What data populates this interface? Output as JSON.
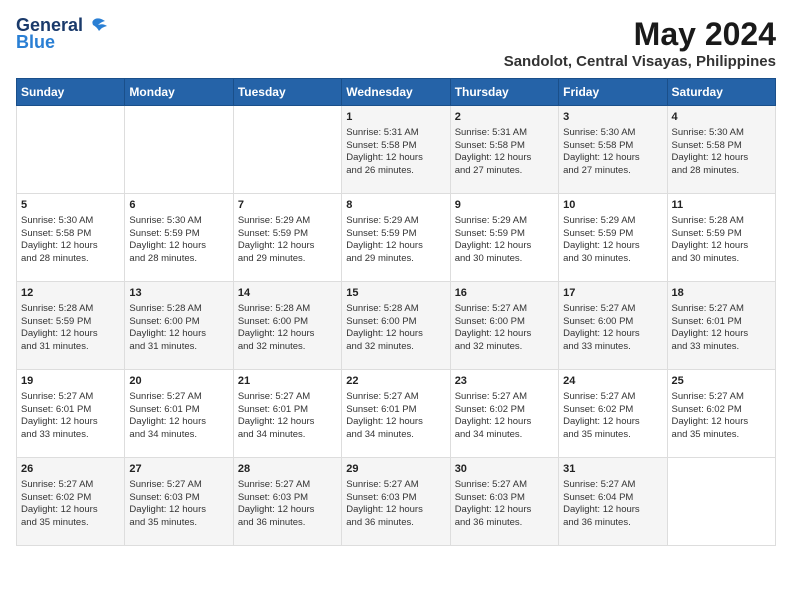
{
  "header": {
    "logo_line1": "General",
    "logo_line2": "Blue",
    "month": "May 2024",
    "location": "Sandolot, Central Visayas, Philippines"
  },
  "days_of_week": [
    "Sunday",
    "Monday",
    "Tuesday",
    "Wednesday",
    "Thursday",
    "Friday",
    "Saturday"
  ],
  "weeks": [
    [
      {
        "day": "",
        "content": ""
      },
      {
        "day": "",
        "content": ""
      },
      {
        "day": "",
        "content": ""
      },
      {
        "day": "1",
        "content": "Sunrise: 5:31 AM\nSunset: 5:58 PM\nDaylight: 12 hours\nand 26 minutes."
      },
      {
        "day": "2",
        "content": "Sunrise: 5:31 AM\nSunset: 5:58 PM\nDaylight: 12 hours\nand 27 minutes."
      },
      {
        "day": "3",
        "content": "Sunrise: 5:30 AM\nSunset: 5:58 PM\nDaylight: 12 hours\nand 27 minutes."
      },
      {
        "day": "4",
        "content": "Sunrise: 5:30 AM\nSunset: 5:58 PM\nDaylight: 12 hours\nand 28 minutes."
      }
    ],
    [
      {
        "day": "5",
        "content": "Sunrise: 5:30 AM\nSunset: 5:58 PM\nDaylight: 12 hours\nand 28 minutes."
      },
      {
        "day": "6",
        "content": "Sunrise: 5:30 AM\nSunset: 5:59 PM\nDaylight: 12 hours\nand 28 minutes."
      },
      {
        "day": "7",
        "content": "Sunrise: 5:29 AM\nSunset: 5:59 PM\nDaylight: 12 hours\nand 29 minutes."
      },
      {
        "day": "8",
        "content": "Sunrise: 5:29 AM\nSunset: 5:59 PM\nDaylight: 12 hours\nand 29 minutes."
      },
      {
        "day": "9",
        "content": "Sunrise: 5:29 AM\nSunset: 5:59 PM\nDaylight: 12 hours\nand 30 minutes."
      },
      {
        "day": "10",
        "content": "Sunrise: 5:29 AM\nSunset: 5:59 PM\nDaylight: 12 hours\nand 30 minutes."
      },
      {
        "day": "11",
        "content": "Sunrise: 5:28 AM\nSunset: 5:59 PM\nDaylight: 12 hours\nand 30 minutes."
      }
    ],
    [
      {
        "day": "12",
        "content": "Sunrise: 5:28 AM\nSunset: 5:59 PM\nDaylight: 12 hours\nand 31 minutes."
      },
      {
        "day": "13",
        "content": "Sunrise: 5:28 AM\nSunset: 6:00 PM\nDaylight: 12 hours\nand 31 minutes."
      },
      {
        "day": "14",
        "content": "Sunrise: 5:28 AM\nSunset: 6:00 PM\nDaylight: 12 hours\nand 32 minutes."
      },
      {
        "day": "15",
        "content": "Sunrise: 5:28 AM\nSunset: 6:00 PM\nDaylight: 12 hours\nand 32 minutes."
      },
      {
        "day": "16",
        "content": "Sunrise: 5:27 AM\nSunset: 6:00 PM\nDaylight: 12 hours\nand 32 minutes."
      },
      {
        "day": "17",
        "content": "Sunrise: 5:27 AM\nSunset: 6:00 PM\nDaylight: 12 hours\nand 33 minutes."
      },
      {
        "day": "18",
        "content": "Sunrise: 5:27 AM\nSunset: 6:01 PM\nDaylight: 12 hours\nand 33 minutes."
      }
    ],
    [
      {
        "day": "19",
        "content": "Sunrise: 5:27 AM\nSunset: 6:01 PM\nDaylight: 12 hours\nand 33 minutes."
      },
      {
        "day": "20",
        "content": "Sunrise: 5:27 AM\nSunset: 6:01 PM\nDaylight: 12 hours\nand 34 minutes."
      },
      {
        "day": "21",
        "content": "Sunrise: 5:27 AM\nSunset: 6:01 PM\nDaylight: 12 hours\nand 34 minutes."
      },
      {
        "day": "22",
        "content": "Sunrise: 5:27 AM\nSunset: 6:01 PM\nDaylight: 12 hours\nand 34 minutes."
      },
      {
        "day": "23",
        "content": "Sunrise: 5:27 AM\nSunset: 6:02 PM\nDaylight: 12 hours\nand 34 minutes."
      },
      {
        "day": "24",
        "content": "Sunrise: 5:27 AM\nSunset: 6:02 PM\nDaylight: 12 hours\nand 35 minutes."
      },
      {
        "day": "25",
        "content": "Sunrise: 5:27 AM\nSunset: 6:02 PM\nDaylight: 12 hours\nand 35 minutes."
      }
    ],
    [
      {
        "day": "26",
        "content": "Sunrise: 5:27 AM\nSunset: 6:02 PM\nDaylight: 12 hours\nand 35 minutes."
      },
      {
        "day": "27",
        "content": "Sunrise: 5:27 AM\nSunset: 6:03 PM\nDaylight: 12 hours\nand 35 minutes."
      },
      {
        "day": "28",
        "content": "Sunrise: 5:27 AM\nSunset: 6:03 PM\nDaylight: 12 hours\nand 36 minutes."
      },
      {
        "day": "29",
        "content": "Sunrise: 5:27 AM\nSunset: 6:03 PM\nDaylight: 12 hours\nand 36 minutes."
      },
      {
        "day": "30",
        "content": "Sunrise: 5:27 AM\nSunset: 6:03 PM\nDaylight: 12 hours\nand 36 minutes."
      },
      {
        "day": "31",
        "content": "Sunrise: 5:27 AM\nSunset: 6:04 PM\nDaylight: 12 hours\nand 36 minutes."
      },
      {
        "day": "",
        "content": ""
      }
    ]
  ]
}
